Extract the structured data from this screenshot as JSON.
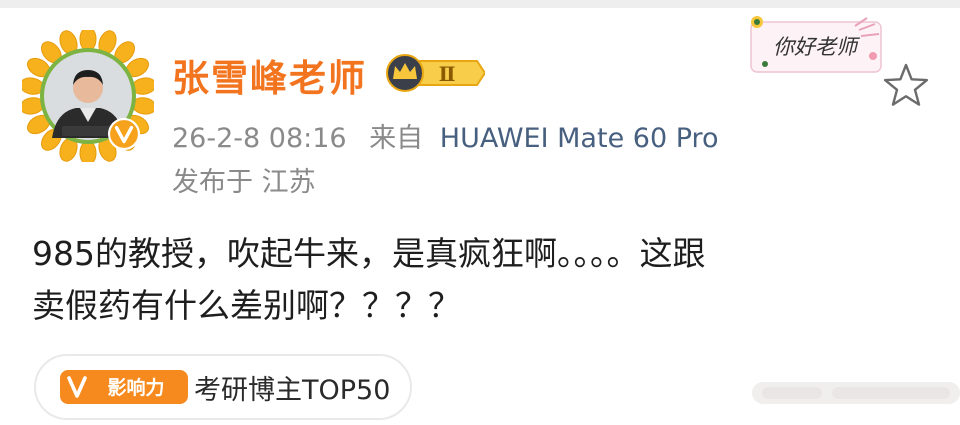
{
  "post": {
    "author_name": "张雪峰老师",
    "level_badge": "Ⅱ",
    "timestamp": "26-2-8 08:16",
    "source_prefix": "来自",
    "device": "HUAWEI Mate 60 Pro",
    "location": "发布于 江苏",
    "body_line1": "985的教授，吹起牛来，是真疯狂啊。。。。这跟",
    "body_line2": "卖假药有什么差别啊？？？？"
  },
  "sticker": {
    "text": "你好老师"
  },
  "influence": {
    "icon_label": "影响力",
    "label": "考研博主TOP50"
  },
  "colors": {
    "author_name": "#f3741f",
    "meta_gray": "#8a8a8a",
    "device_blue": "#48607f",
    "influence_orange": "#f78a1e",
    "sunflower_petal": "#f6b11c",
    "avatar_ring": "#7cb342",
    "verified_badge": "#f7a21c"
  },
  "icons": {
    "avatar": "sunflower-frame-avatar",
    "verified": "verified-v-icon",
    "level": "crown-level-icon",
    "favorite": "star-outline-icon",
    "influence": "v-influence-icon"
  }
}
